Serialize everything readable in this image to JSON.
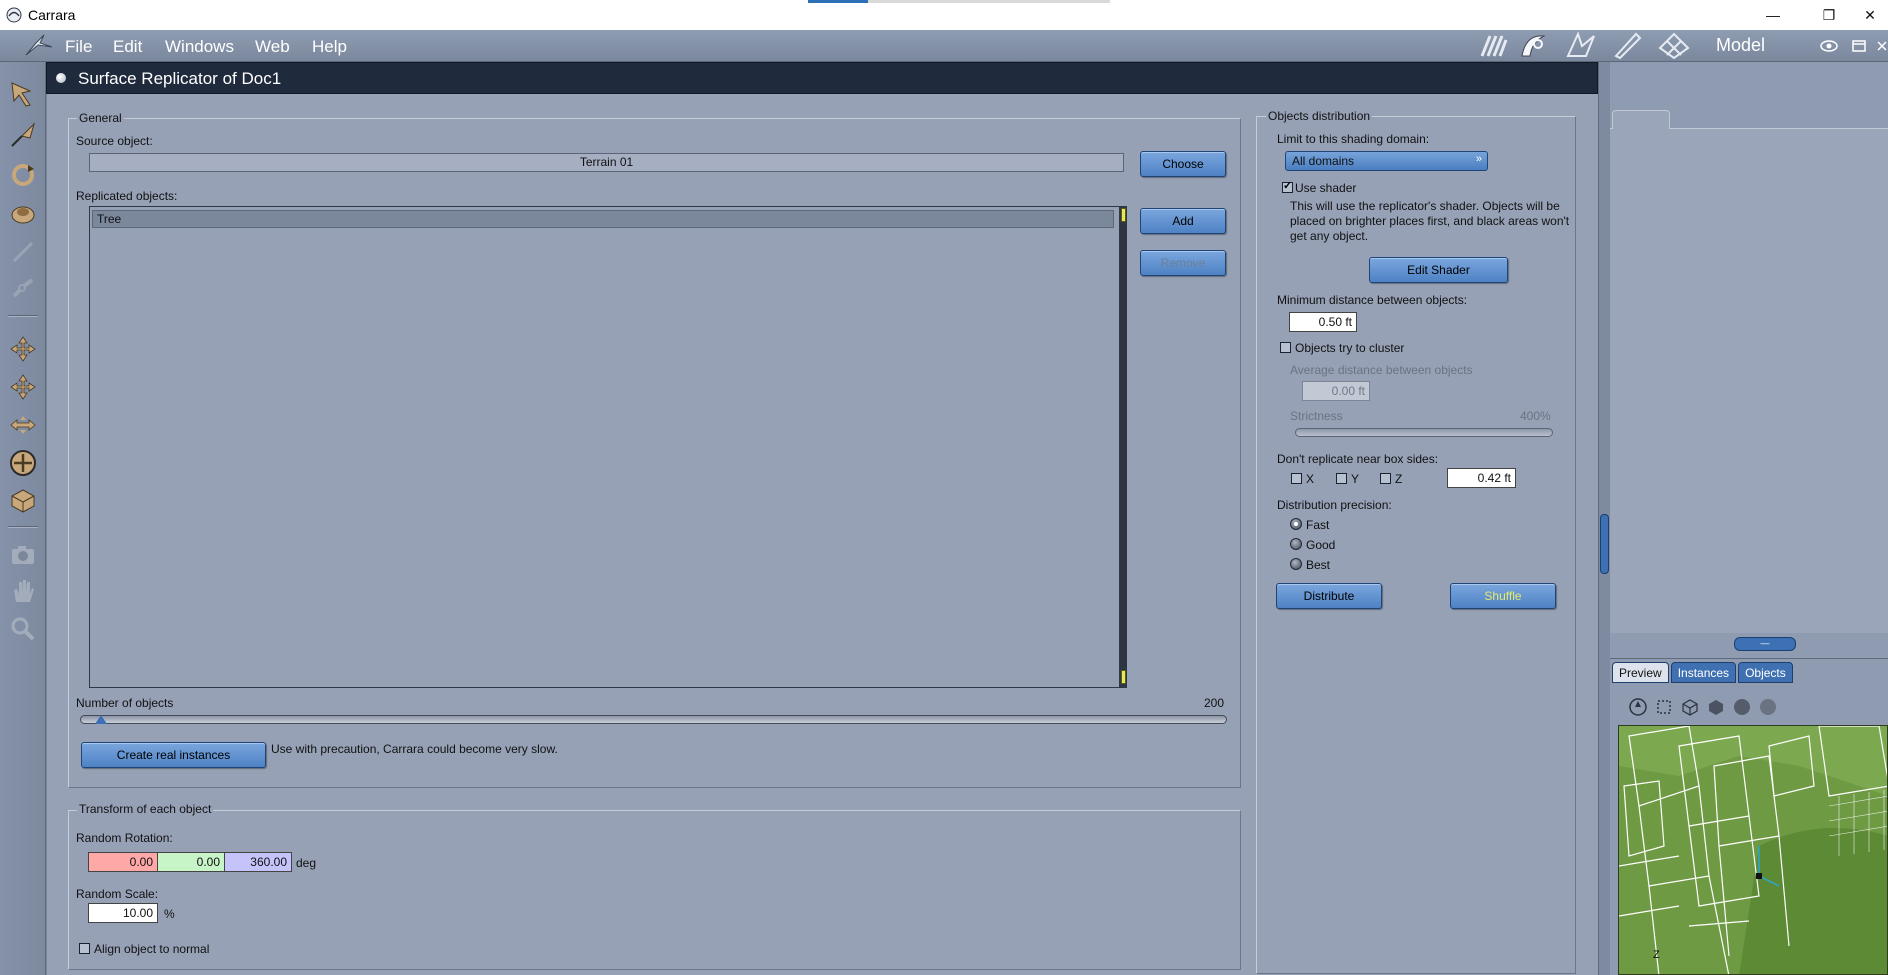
{
  "window": {
    "title": "Carrara",
    "minimize_glyph": "—",
    "restore_glyph": "❐",
    "close_glyph": "✕"
  },
  "menu": {
    "items": [
      "File",
      "Edit",
      "Windows",
      "Web",
      "Help"
    ],
    "room_label": "Model",
    "room_icons": [
      "hand-room-icon",
      "assemble-room-icon",
      "storyboard-room-icon",
      "texture-room-icon",
      "render-room-icon"
    ]
  },
  "toolbar": {
    "tools": [
      "arrow-tool-icon",
      "select-tool-icon",
      "rotate-tool-icon",
      "twist-tool-icon",
      "pen-tool-icon",
      "link-tool-icon",
      "move-tool-icon",
      "move-planar-tool-icon",
      "move-horizontal-tool-icon",
      "sphere-move-tool-icon",
      "box-scale-tool-icon",
      "camera-tool-icon",
      "hand-tool-icon",
      "zoom-tool-icon"
    ]
  },
  "dialog": {
    "title": "Surface Replicator of Doc1",
    "general": {
      "legend": "General",
      "source_label": "Source object:",
      "source_value": "Terrain 01",
      "choose_button": "Choose",
      "replicated_label": "Replicated objects:",
      "replicated_items": [
        "Tree"
      ],
      "add_button": "Add",
      "remove_button": "Remove",
      "count_label": "Number of objects",
      "count_value": "200",
      "count_fraction": 0.012,
      "create_instances_button": "Create real instances",
      "instances_warning": "Use with precaution, Carrara could become very slow."
    },
    "transform": {
      "legend": "Transform of each object",
      "rotation_label": "Random Rotation:",
      "rotation_x": "0.00",
      "rotation_y": "0.00",
      "rotation_z": "360.00",
      "rotation_unit": "deg",
      "scale_label": "Random Scale:",
      "scale_value": "10.00",
      "scale_unit": "%",
      "align_label": "Align object to normal",
      "align_checked": false
    },
    "distribution": {
      "legend": "Objects distribution",
      "domain_label": "Limit to this shading domain:",
      "domain_value": "All domains",
      "use_shader_label": "Use shader",
      "use_shader_checked": true,
      "shader_note": "This will use the replicator's shader. Objects will be placed on brighter places first, and black areas won't get any object.",
      "edit_shader_button": "Edit Shader",
      "min_distance_label": "Minimum distance between objects:",
      "min_distance_value": "0.50 ft",
      "cluster_label": "Objects try to cluster",
      "cluster_checked": false,
      "avg_distance_label": "Average distance between objects",
      "avg_distance_value": "0.00 ft",
      "strictness_label": "Strictness",
      "strictness_value": "400%",
      "box_sides_label": "Don't replicate near box sides:",
      "box_x_label": "X",
      "box_y_label": "Y",
      "box_z_label": "Z",
      "box_distance_value": "0.42 ft",
      "precision_label": "Distribution precision:",
      "precision_options": [
        "Fast",
        "Good",
        "Best"
      ],
      "precision_selected": "Fast",
      "distribute_button": "Distribute",
      "shuffle_button": "Shuffle"
    }
  },
  "side_panel": {
    "tabs": [
      "Preview",
      "Instances",
      "Objects"
    ],
    "active_tab": "Preview",
    "splitter_glyph": "—",
    "viewport_axis_label": "Z"
  }
}
